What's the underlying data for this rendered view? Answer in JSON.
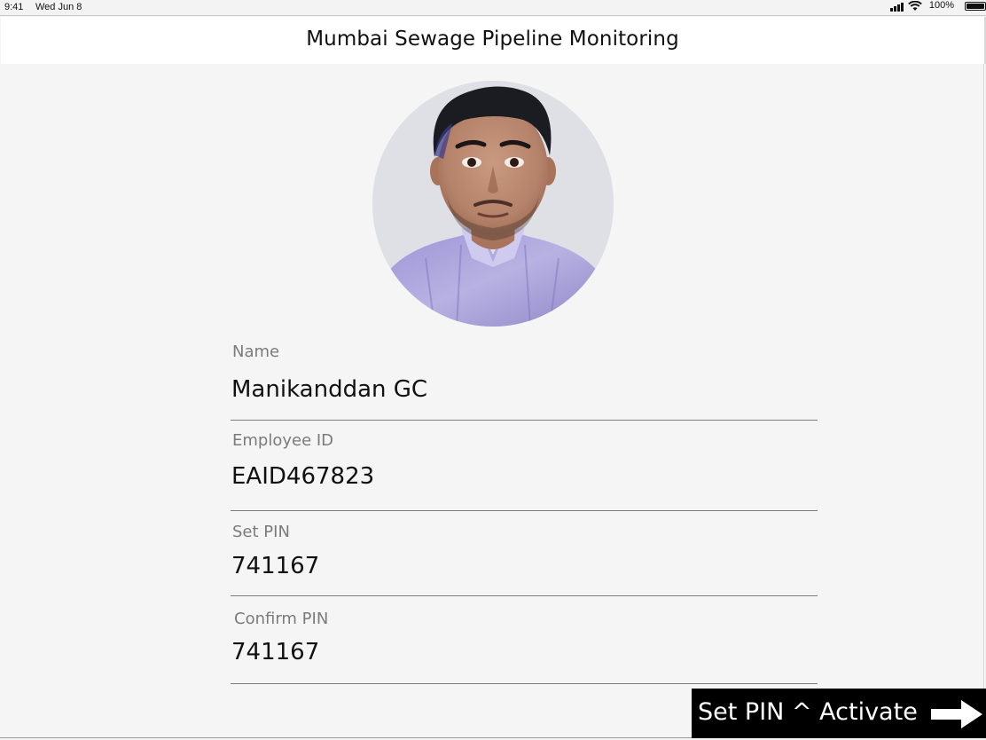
{
  "status_bar": {
    "time": "9:41",
    "date": "Wed Jun 8",
    "battery_percent": "100%",
    "icons": [
      "signal-icon",
      "wifi-icon",
      "battery-icon"
    ]
  },
  "header": {
    "title": "Mumbai Sewage Pipeline Monitoring"
  },
  "profile": {
    "avatar_icon": "profile-photo"
  },
  "form": {
    "name": {
      "label": "Name",
      "value": "Manikanddan GC"
    },
    "employee_id": {
      "label": "Employee ID",
      "value": "EAID467823"
    },
    "set_pin": {
      "label": "Set PIN",
      "value": "741167"
    },
    "confirm_pin": {
      "label": "Confirm PIN",
      "value": "741167"
    }
  },
  "action": {
    "label": "Set PIN ^ Activate",
    "icon": "arrow-right-icon"
  },
  "colors": {
    "background": "#f6f5f6",
    "header_bg": "#ffffff",
    "button_bg": "#000000",
    "button_text": "#ffffff",
    "label_text": "#7b7b7b"
  }
}
